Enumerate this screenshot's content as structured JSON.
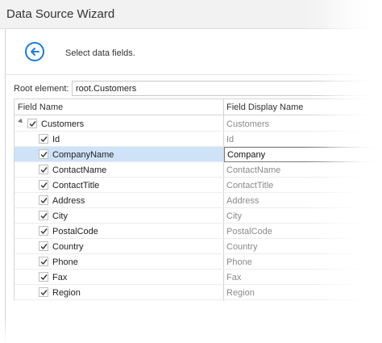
{
  "window": {
    "title": "Data Source Wizard"
  },
  "header": {
    "subtitle": "Select data fields."
  },
  "root": {
    "label": "Root element:",
    "value": "root.Customers"
  },
  "grid": {
    "columns": [
      "Field Name",
      "Field Display Name"
    ],
    "parent": {
      "name": "Customers",
      "display": "Customers",
      "checked": true,
      "expanded": true
    },
    "rows": [
      {
        "name": "Id",
        "display": "Id",
        "checked": true
      },
      {
        "name": "CompanyName",
        "display": "Company",
        "checked": true,
        "selected": true,
        "editing": true
      },
      {
        "name": "ContactName",
        "display": "ContactName",
        "checked": true
      },
      {
        "name": "ContactTitle",
        "display": "ContactTitle",
        "checked": true
      },
      {
        "name": "Address",
        "display": "Address",
        "checked": true
      },
      {
        "name": "City",
        "display": "City",
        "checked": true
      },
      {
        "name": "PostalCode",
        "display": "PostalCode",
        "checked": true
      },
      {
        "name": "Country",
        "display": "Country",
        "checked": true
      },
      {
        "name": "Phone",
        "display": "Phone",
        "checked": true
      },
      {
        "name": "Fax",
        "display": "Fax",
        "checked": true
      },
      {
        "name": "Region",
        "display": "Region",
        "checked": true
      }
    ]
  },
  "colors": {
    "accent": "#1f7ad4",
    "selection": "#cfe3f8",
    "muted_text": "#8a8a8a"
  },
  "icons": {
    "back": "back-arrow-circle-icon",
    "check": "check-icon",
    "expander": "tree-expander-icon"
  }
}
